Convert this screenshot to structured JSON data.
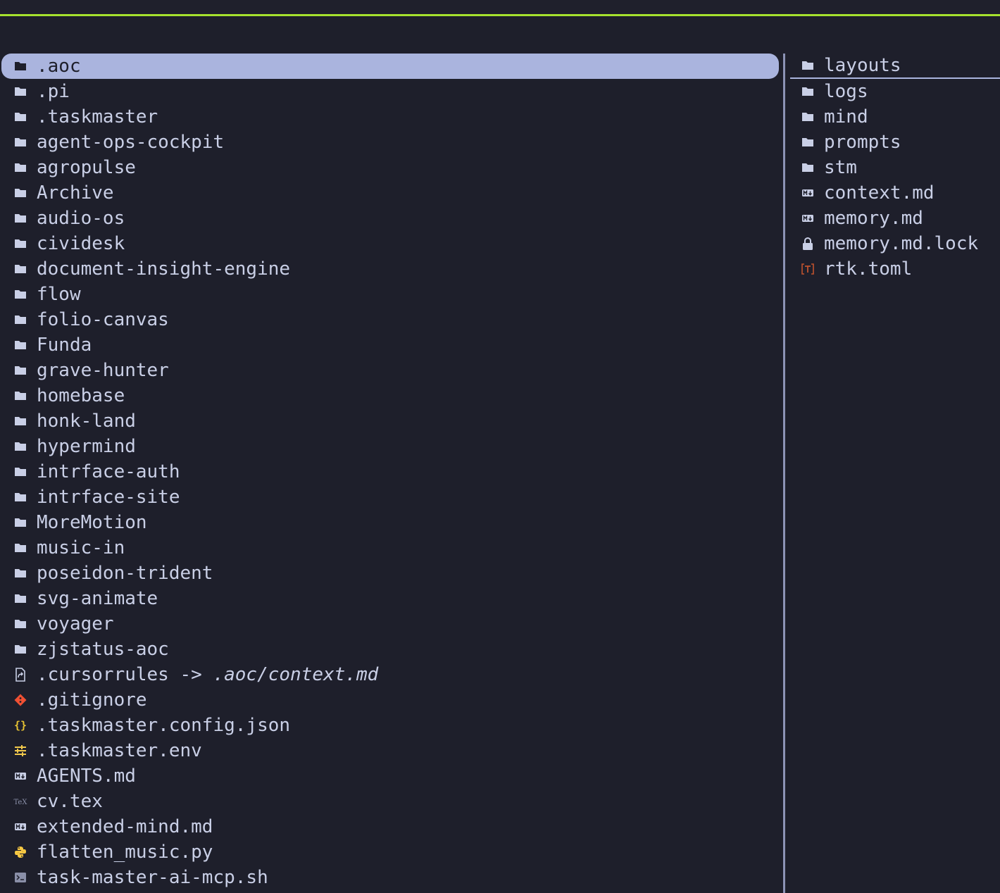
{
  "left_pane": {
    "items": [
      {
        "name": ".aoc",
        "icon": "folder-icon",
        "selected": true
      },
      {
        "name": ".pi",
        "icon": "folder-icon"
      },
      {
        "name": ".taskmaster",
        "icon": "folder-icon"
      },
      {
        "name": "agent-ops-cockpit",
        "icon": "folder-icon"
      },
      {
        "name": "agropulse",
        "icon": "folder-icon"
      },
      {
        "name": "Archive",
        "icon": "folder-icon"
      },
      {
        "name": "audio-os",
        "icon": "folder-icon"
      },
      {
        "name": "cividesk",
        "icon": "folder-icon"
      },
      {
        "name": "document-insight-engine",
        "icon": "folder-icon"
      },
      {
        "name": "flow",
        "icon": "folder-icon"
      },
      {
        "name": "folio-canvas",
        "icon": "folder-icon"
      },
      {
        "name": "Funda",
        "icon": "folder-icon"
      },
      {
        "name": "grave-hunter",
        "icon": "folder-icon"
      },
      {
        "name": "homebase",
        "icon": "folder-icon"
      },
      {
        "name": "honk-land",
        "icon": "folder-icon"
      },
      {
        "name": "hypermind",
        "icon": "folder-icon"
      },
      {
        "name": "intrface-auth",
        "icon": "folder-icon"
      },
      {
        "name": "intrface-site",
        "icon": "folder-icon"
      },
      {
        "name": "MoreMotion",
        "icon": "folder-icon"
      },
      {
        "name": "music-in",
        "icon": "folder-icon"
      },
      {
        "name": "poseidon-trident",
        "icon": "folder-icon"
      },
      {
        "name": "svg-animate",
        "icon": "folder-icon"
      },
      {
        "name": "voyager",
        "icon": "folder-icon"
      },
      {
        "name": "zjstatus-aoc",
        "icon": "folder-icon"
      },
      {
        "name": ".cursorrules",
        "icon": "symlink-icon",
        "link_arrow": "->",
        "link_target": ".aoc/context.md"
      },
      {
        "name": ".gitignore",
        "icon": "git-icon"
      },
      {
        "name": ".taskmaster.config.json",
        "icon": "json-icon"
      },
      {
        "name": ".taskmaster.env",
        "icon": "env-icon"
      },
      {
        "name": "AGENTS.md",
        "icon": "markdown-icon"
      },
      {
        "name": "cv.tex",
        "icon": "tex-icon"
      },
      {
        "name": "extended-mind.md",
        "icon": "markdown-icon"
      },
      {
        "name": "flatten_music.py",
        "icon": "python-icon"
      },
      {
        "name": "task-master-ai-mcp.sh",
        "icon": "shell-icon"
      }
    ]
  },
  "right_pane": {
    "items": [
      {
        "name": "layouts",
        "icon": "folder-icon",
        "underline": true
      },
      {
        "name": "logs",
        "icon": "folder-icon"
      },
      {
        "name": "mind",
        "icon": "folder-icon"
      },
      {
        "name": "prompts",
        "icon": "folder-icon"
      },
      {
        "name": "stm",
        "icon": "folder-icon"
      },
      {
        "name": "context.md",
        "icon": "markdown-icon"
      },
      {
        "name": "memory.md",
        "icon": "markdown-icon"
      },
      {
        "name": "memory.md.lock",
        "icon": "lock-icon"
      },
      {
        "name": "rtk.toml",
        "icon": "toml-icon"
      }
    ]
  },
  "colors": {
    "background": "#1e1f2b",
    "text": "#c9cfe6",
    "selection": "#aab4de",
    "accent_bar": "#a6e22e",
    "git": "#f05033",
    "json": "#e5c233",
    "env": "#f2c94c",
    "python": "#f7c843",
    "toml": "#c0532e",
    "muted": "#8a8fa8"
  }
}
